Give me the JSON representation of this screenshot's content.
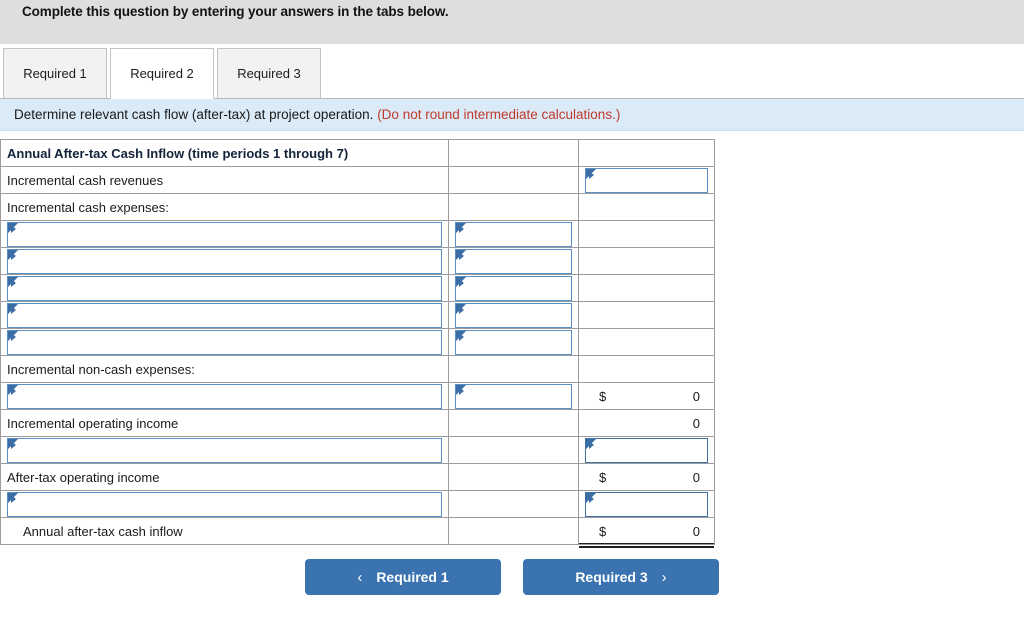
{
  "header": {
    "instruction": "Complete this question by entering your answers in the tabs below."
  },
  "tabs": [
    {
      "label": "Required 1",
      "active": false
    },
    {
      "label": "Required 2",
      "active": true
    },
    {
      "label": "Required 3",
      "active": false
    }
  ],
  "question": {
    "text": "Determine relevant cash flow (after-tax) at project operation.",
    "note": "(Do not round intermediate calculations.)"
  },
  "table": {
    "header": {
      "title": "Annual After-tax Cash Inflow (time periods 1 through 7)",
      "col2": "",
      "col3": ""
    },
    "rows": [
      {
        "type": "label-input",
        "label": "Incremental cash revenues",
        "mid": "",
        "val_control": true,
        "val": ""
      },
      {
        "type": "label-plain",
        "label": "Incremental cash expenses:",
        "mid": "",
        "val": ""
      },
      {
        "type": "dropdown-pair",
        "label": "",
        "mid": "",
        "val": ""
      },
      {
        "type": "dropdown-pair",
        "label": "",
        "mid": "",
        "val": ""
      },
      {
        "type": "dropdown-pair",
        "label": "",
        "mid": "",
        "val": ""
      },
      {
        "type": "dropdown-pair",
        "label": "",
        "mid": "",
        "val": ""
      },
      {
        "type": "dropdown-pair",
        "label": "",
        "mid": "",
        "val": ""
      },
      {
        "type": "label-plain",
        "label": "Incremental non-cash expenses:",
        "mid": "",
        "val": ""
      },
      {
        "type": "dropdown-pair-money",
        "label": "",
        "mid": "",
        "currency": "$",
        "val": "0",
        "underline": true
      },
      {
        "type": "label-money-nocur",
        "label": "Incremental operating income",
        "mid": "",
        "currency": "",
        "val": "0"
      },
      {
        "type": "dropdown-label-input",
        "label": "",
        "mid": "",
        "val": ""
      },
      {
        "type": "label-money",
        "label": "After-tax operating income",
        "mid": "",
        "currency": "$",
        "val": "0"
      },
      {
        "type": "dropdown-label-input",
        "label": "",
        "mid": "",
        "val": ""
      },
      {
        "type": "label-money-total",
        "label": "Annual after-tax cash inflow",
        "mid": "",
        "currency": "$",
        "val": "0",
        "indent": true
      }
    ]
  },
  "nav": {
    "prev_label": "Required 1",
    "prev_icon": "chevron-left-icon",
    "next_label": "Required 3",
    "next_icon": "chevron-right-icon",
    "prev_chevron": "‹",
    "next_chevron": "›"
  },
  "colors": {
    "topbar_bg": "#dedede",
    "question_bg": "#daeaf7",
    "table_header_bg": "#7cade3",
    "button_bg": "#3b73b0",
    "note_color": "#c0392b",
    "input_border": "#5b8ec4"
  }
}
